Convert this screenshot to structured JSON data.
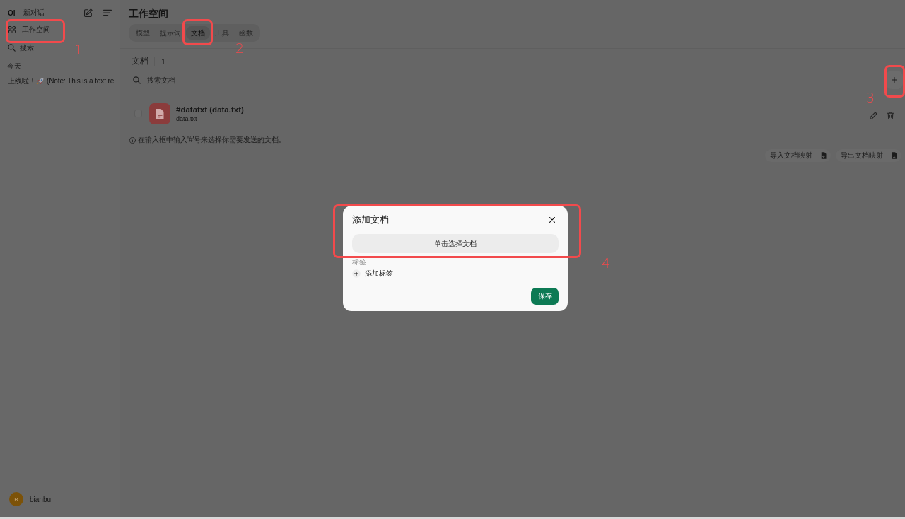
{
  "sidebar": {
    "logo": "OI",
    "new_chat": "新对话",
    "workspace": "工作空间",
    "search_placeholder": "搜索",
    "section": "今天",
    "chats": [
      {
        "title_start": "上线啦！",
        "title_end": "(Note: This is a text re"
      }
    ],
    "user": {
      "initial": "B",
      "name": "bianbu"
    }
  },
  "header": {
    "title": "工作空间",
    "tabs": [
      {
        "label": "模型",
        "selected": false
      },
      {
        "label": "提示词",
        "selected": false
      },
      {
        "label": "文档",
        "selected": true
      },
      {
        "label": "工具",
        "selected": false
      },
      {
        "label": "函数",
        "selected": false
      }
    ]
  },
  "documents": {
    "title": "文档",
    "count": "1",
    "search_placeholder": "搜索文档",
    "items": [
      {
        "title": "#datatxt (data.txt)",
        "filename": "data.txt",
        "checked": false
      }
    ],
    "hint": "在输入框中输入'#'号来选择你需要发送的文档。",
    "buttons": [
      {
        "label": "导入文档映射",
        "kind": "import"
      },
      {
        "label": "导出文档映射",
        "kind": "export"
      }
    ]
  },
  "modal": {
    "title": "添加文档",
    "choose_button": "单击选择文档",
    "tags_label": "标签",
    "add_tag": "添加标签",
    "save": "保存"
  },
  "annotations": [
    {
      "label": "1"
    },
    {
      "label": "2"
    },
    {
      "label": "3"
    },
    {
      "label": "4"
    }
  ]
}
